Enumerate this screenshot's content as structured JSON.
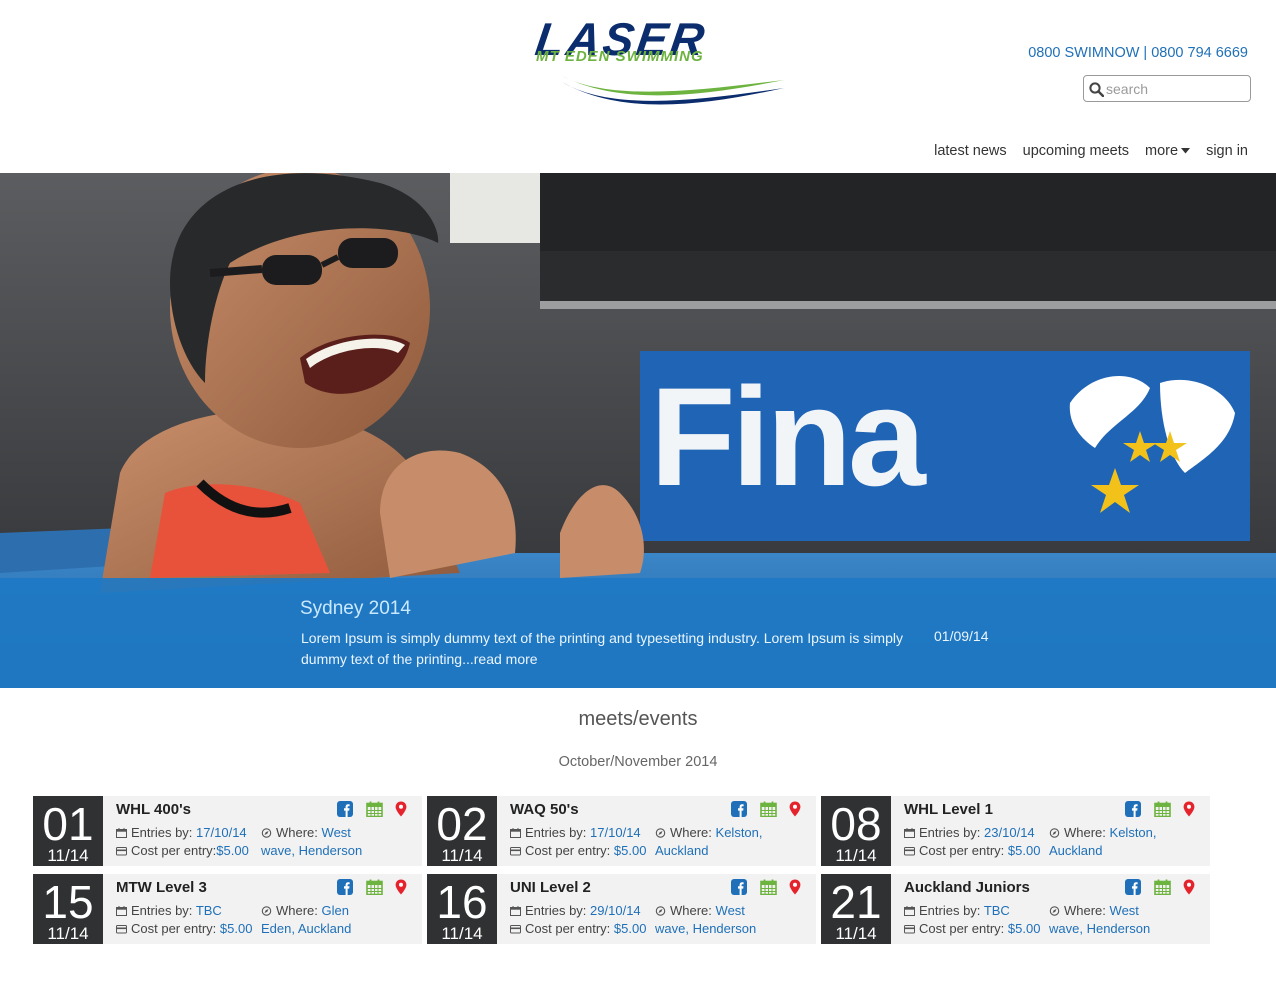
{
  "brand": {
    "logo_main": "LASER",
    "logo_sub": "MT EDEN SWIMMING"
  },
  "header": {
    "phone": "0800 SWIMNOW | 0800 794 6669",
    "search_placeholder": "search"
  },
  "nav": {
    "items": [
      {
        "label": "latest news"
      },
      {
        "label": "upcoming meets"
      },
      {
        "label": "more"
      },
      {
        "label": "sign in"
      }
    ]
  },
  "hero": {
    "title": "Sydney 2014",
    "text": "Lorem Ipsum is simply dummy text of the printing and typesetting industry. Lorem Ipsum is simply dummy text of the printing...read more",
    "date": "01/09/14",
    "banner_text": "Fina"
  },
  "meets": {
    "title": "meets/events",
    "subtitle": "October/November 2014",
    "labels": {
      "entries": "Entries by:",
      "where": "Where:",
      "cost": "Cost per entry:"
    },
    "events": [
      {
        "day": "01",
        "month": "11/14",
        "name": "WHL 400's",
        "entries": "17/10/14",
        "where_1": "West",
        "where_2": "wave, Henderson",
        "cost": "$5.00"
      },
      {
        "day": "02",
        "month": "11/14",
        "name": "WAQ 50's",
        "entries": "17/10/14",
        "where_1": "Kelston,",
        "where_2": "Auckland",
        "cost": "$5.00"
      },
      {
        "day": "08",
        "month": "11/14",
        "name": "WHL Level 1",
        "entries": "23/10/14",
        "where_1": "Kelston,",
        "where_2": "Auckland",
        "cost": "$5.00"
      },
      {
        "day": "15",
        "month": "11/14",
        "name": "MTW Level 3",
        "entries": "TBC",
        "where_1": "Glen",
        "where_2": "Eden, Auckland",
        "cost": "$5.00"
      },
      {
        "day": "16",
        "month": "11/14",
        "name": "UNI Level 2",
        "entries": "29/10/14",
        "where_1": "West",
        "where_2": "wave, Henderson",
        "cost": "$5.00"
      },
      {
        "day": "21",
        "month": "11/14",
        "name": "Auckland Juniors",
        "entries": "TBC",
        "where_1": "West",
        "where_2": "wave, Henderson",
        "cost": "$5.00"
      }
    ]
  },
  "colors": {
    "brand_navy": "#0b2d6e",
    "brand_green": "#6db33f",
    "link_blue": "#1f70b8",
    "caption_blue": "#1f79c4",
    "date_bg": "#2f3133"
  }
}
